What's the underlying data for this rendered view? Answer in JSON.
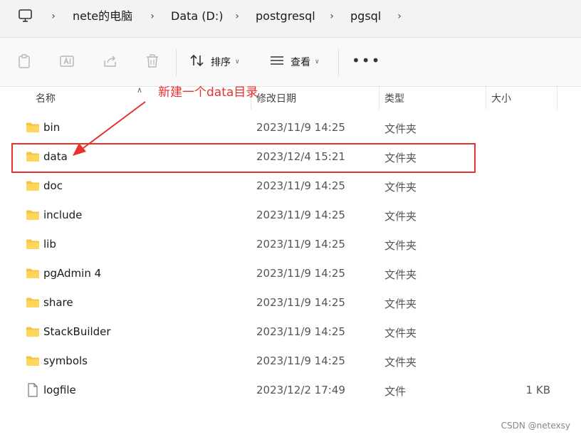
{
  "address_bar": {
    "breadcrumbs": [
      "nete的电脑",
      "Data (D:)",
      "postgresql",
      "pgsql"
    ]
  },
  "toolbar": {
    "sort_label": "排序",
    "view_label": "查看"
  },
  "columns": {
    "name": "名称",
    "modified": "修改日期",
    "type": "类型",
    "size": "大小"
  },
  "files": [
    {
      "name": "bin",
      "modified": "2023/11/9 14:25",
      "type": "文件夹",
      "size": "",
      "icon": "folder-icon"
    },
    {
      "name": "data",
      "modified": "2023/12/4 15:21",
      "type": "文件夹",
      "size": "",
      "icon": "folder-icon"
    },
    {
      "name": "doc",
      "modified": "2023/11/9 14:25",
      "type": "文件夹",
      "size": "",
      "icon": "folder-icon"
    },
    {
      "name": "include",
      "modified": "2023/11/9 14:25",
      "type": "文件夹",
      "size": "",
      "icon": "folder-icon"
    },
    {
      "name": "lib",
      "modified": "2023/11/9 14:25",
      "type": "文件夹",
      "size": "",
      "icon": "folder-icon"
    },
    {
      "name": "pgAdmin 4",
      "modified": "2023/11/9 14:25",
      "type": "文件夹",
      "size": "",
      "icon": "folder-icon"
    },
    {
      "name": "share",
      "modified": "2023/11/9 14:25",
      "type": "文件夹",
      "size": "",
      "icon": "folder-icon"
    },
    {
      "name": "StackBuilder",
      "modified": "2023/11/9 14:25",
      "type": "文件夹",
      "size": "",
      "icon": "folder-icon"
    },
    {
      "name": "symbols",
      "modified": "2023/11/9 14:25",
      "type": "文件夹",
      "size": "",
      "icon": "folder-icon"
    },
    {
      "name": "logfile",
      "modified": "2023/12/2 17:49",
      "type": "文件",
      "size": "1 KB",
      "icon": "file-icon"
    }
  ],
  "annotation": {
    "text": "新建一个data目录",
    "color": "#e8322f"
  },
  "watermark": "CSDN @netexsy"
}
